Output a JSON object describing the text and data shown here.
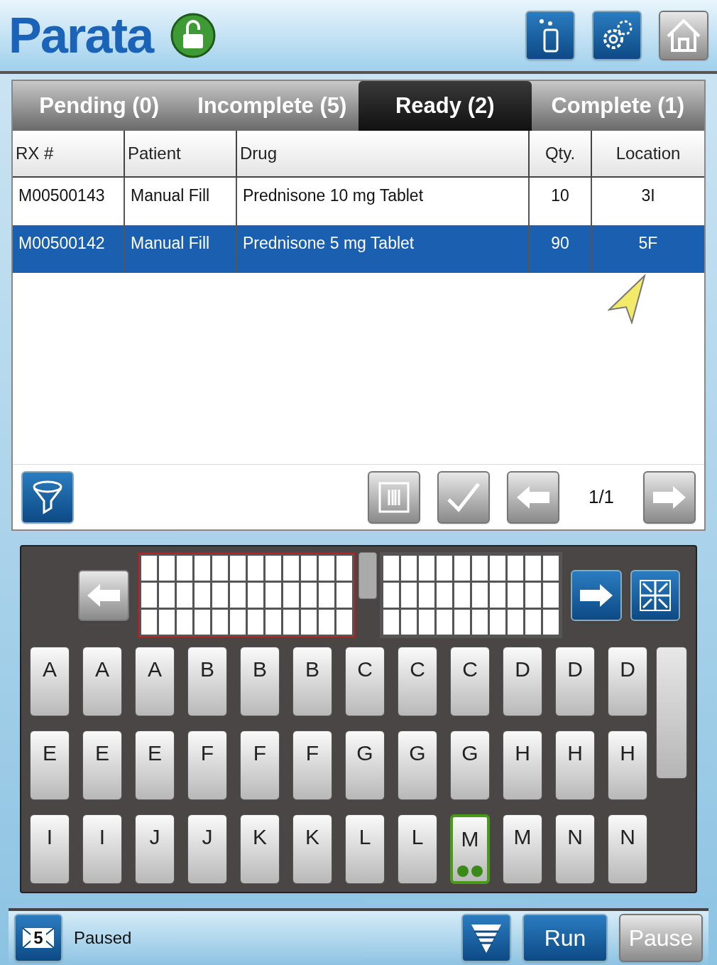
{
  "header": {
    "logo": "Parata",
    "locked": false
  },
  "tabs": [
    {
      "label": "Pending (0)",
      "selected": false
    },
    {
      "label": "Incomplete (5)",
      "selected": false
    },
    {
      "label": "Ready (2)",
      "selected": true
    },
    {
      "label": "Complete (1)",
      "selected": false
    }
  ],
  "table": {
    "columns": [
      "RX #",
      "Patient",
      "Drug",
      "Qty.",
      "Location"
    ],
    "rows": [
      {
        "cells": [
          "M00500143",
          "Manual Fill",
          "Prednisone 10 mg Tablet",
          "10",
          "3I"
        ],
        "selected": false
      },
      {
        "cells": [
          "M00500142",
          "Manual Fill",
          "Prednisone 5 mg Tablet",
          "90",
          "5F"
        ],
        "selected": true
      }
    ]
  },
  "pager": {
    "page": "1/1"
  },
  "card_grids": [
    {
      "selected": true
    },
    {
      "selected": false
    }
  ],
  "keys": [
    [
      {
        "label": "A",
        "selected": false
      },
      {
        "label": "A",
        "selected": false
      },
      {
        "label": "A",
        "selected": false
      },
      {
        "label": "B",
        "selected": false
      },
      {
        "label": "B",
        "selected": false
      },
      {
        "label": "B",
        "selected": false
      },
      {
        "label": "C",
        "selected": false
      },
      {
        "label": "C",
        "selected": false
      },
      {
        "label": "C",
        "selected": false
      },
      {
        "label": "D",
        "selected": false
      },
      {
        "label": "D",
        "selected": false
      },
      {
        "label": "D",
        "selected": false
      }
    ],
    [
      {
        "label": "E",
        "selected": false
      },
      {
        "label": "E",
        "selected": false
      },
      {
        "label": "E",
        "selected": false
      },
      {
        "label": "F",
        "selected": false
      },
      {
        "label": "F",
        "selected": false
      },
      {
        "label": "F",
        "selected": false
      },
      {
        "label": "G",
        "selected": false
      },
      {
        "label": "G",
        "selected": false
      },
      {
        "label": "G",
        "selected": false
      },
      {
        "label": "H",
        "selected": false
      },
      {
        "label": "H",
        "selected": false
      },
      {
        "label": "H",
        "selected": false
      }
    ],
    [
      {
        "label": "I",
        "selected": false
      },
      {
        "label": "I",
        "selected": false
      },
      {
        "label": "J",
        "selected": false
      },
      {
        "label": "J",
        "selected": false
      },
      {
        "label": "K",
        "selected": false
      },
      {
        "label": "K",
        "selected": false
      },
      {
        "label": "L",
        "selected": false
      },
      {
        "label": "L",
        "selected": false
      },
      {
        "label": "M",
        "selected": true
      },
      {
        "label": "M",
        "selected": false
      },
      {
        "label": "N",
        "selected": false
      },
      {
        "label": "N",
        "selected": false
      }
    ]
  ],
  "status_bar": {
    "messages": "5",
    "status": "Paused",
    "run": "Run",
    "pause": "Pause"
  }
}
